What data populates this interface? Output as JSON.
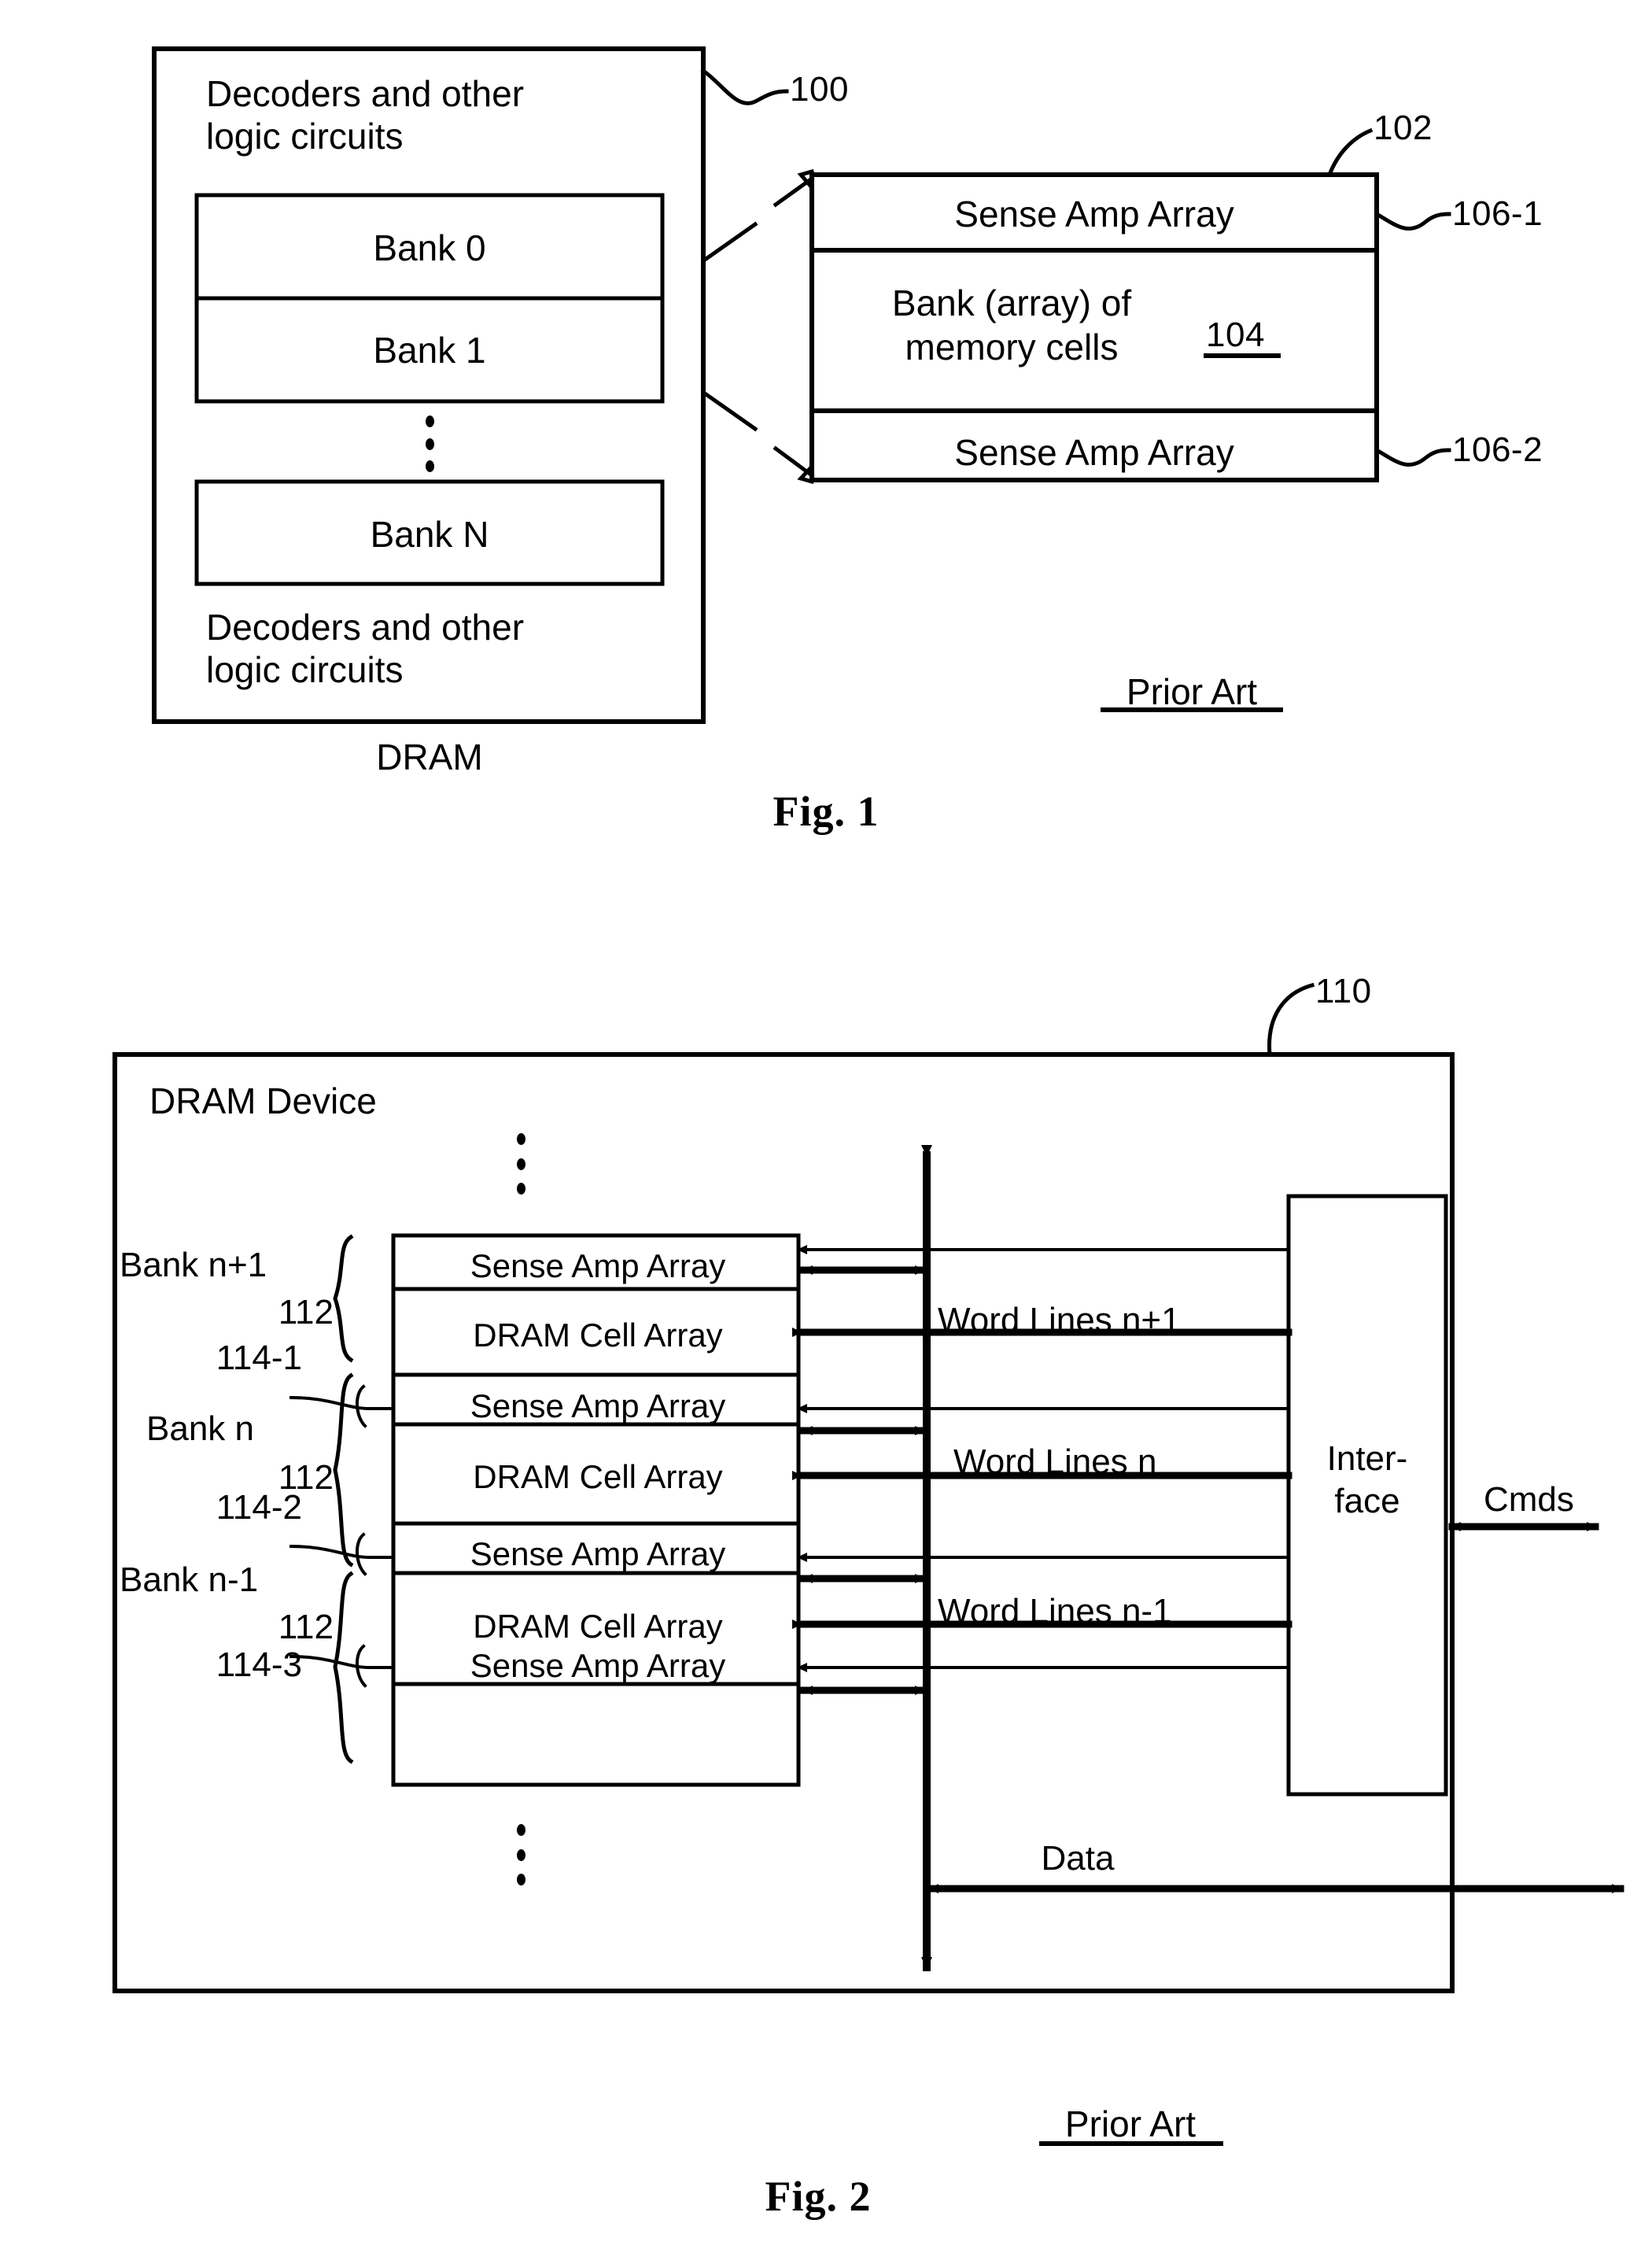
{
  "figure1": {
    "ref_dram_chip": "100",
    "ref_bank_block": "102",
    "ref_bank_array": "104",
    "ref_sense_amp_top": "106-1",
    "ref_sense_amp_bottom": "106-2",
    "decoders_top": "Decoders and other\nlogic circuits",
    "decoders_bottom": "Decoders and other\nlogic circuits",
    "banks": [
      "Bank 0",
      "Bank 1",
      "Bank N"
    ],
    "vertical_ellipsis": "⋮",
    "detail": {
      "sense_amp_top": "Sense Amp Array",
      "bank_array_line1": "Bank (array) of",
      "bank_array_line2": "memory cells",
      "sense_amp_bottom": "Sense Amp Array"
    },
    "device_label": "DRAM",
    "prior_art": "Prior Art",
    "caption": "Fig. 1"
  },
  "figure2": {
    "ref_device": "110",
    "device_label": "DRAM Device",
    "bank_refs": [
      {
        "name": "Bank n+1",
        "num": "112"
      },
      {
        "name": "Bank n",
        "num": "112"
      },
      {
        "name": "Bank n-1",
        "num": "112"
      }
    ],
    "sense_amp_refs": [
      "114-1",
      "114-2",
      "114-3"
    ],
    "stack": [
      {
        "type": "sense-amp",
        "label": "Sense Amp Array"
      },
      {
        "type": "cell-array",
        "label": "DRAM Cell Array"
      },
      {
        "type": "sense-amp",
        "label": "Sense Amp Array"
      },
      {
        "type": "cell-array",
        "label": "DRAM Cell Array"
      },
      {
        "type": "sense-amp",
        "label": "Sense Amp Array"
      },
      {
        "type": "cell-array",
        "label": "DRAM Cell Array"
      },
      {
        "type": "sense-amp",
        "label": "Sense Amp Array"
      }
    ],
    "word_lines": [
      "Word Lines n+1",
      "Word Lines n",
      "Word Lines n-1"
    ],
    "interface_line1": "Inter-",
    "interface_line2": "face",
    "cmds_label": "Cmds",
    "data_label": "Data",
    "prior_art": "Prior Art",
    "caption": "Fig. 2"
  }
}
